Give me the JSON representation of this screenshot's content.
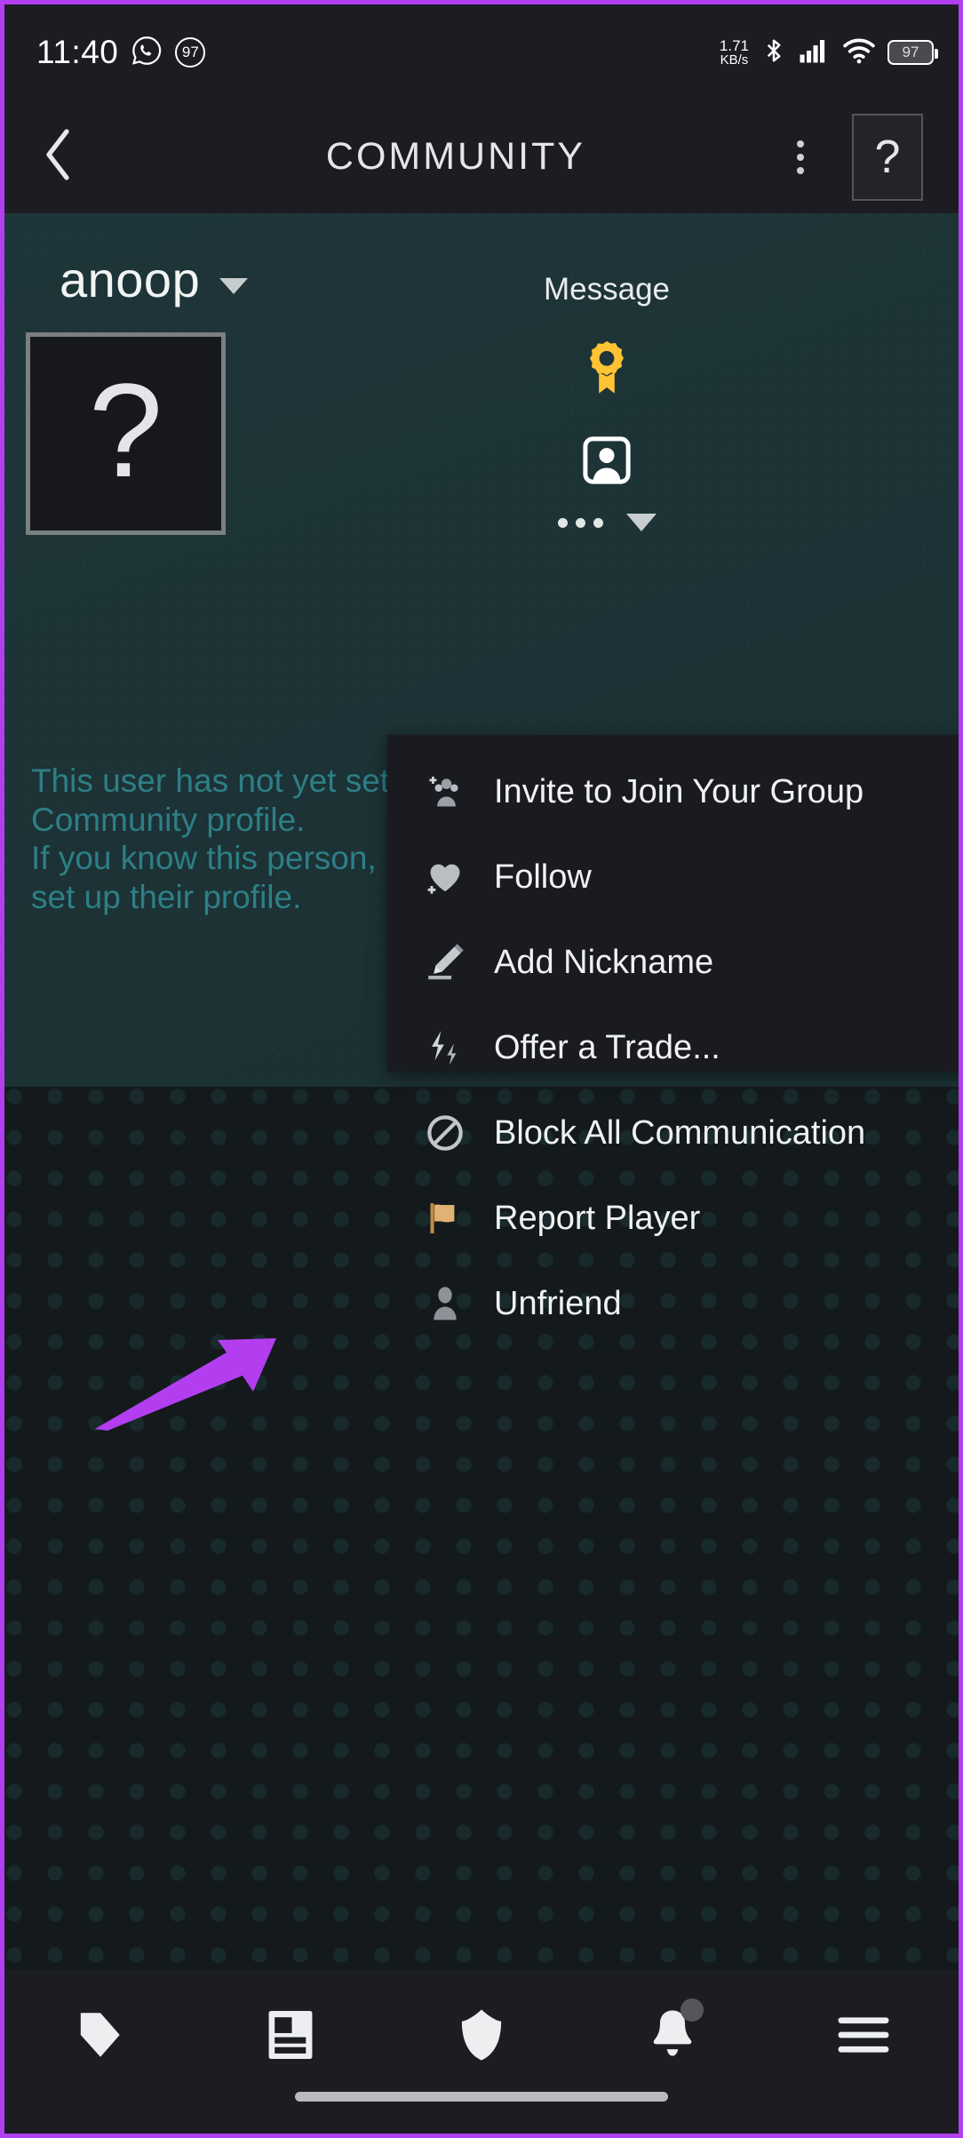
{
  "status_bar": {
    "time": "11:40",
    "whatsapp_icon": "whatsapp-icon",
    "notification_count": "97",
    "net_speed_value": "1.71",
    "net_speed_unit": "KB/s",
    "bluetooth_icon": "bluetooth-icon",
    "signal_icon": "cellular-signal-icon",
    "wifi_icon": "wifi-icon",
    "battery_level": "97"
  },
  "nav_bar": {
    "back_icon": "back-chevron-icon",
    "title": "COMMUNITY",
    "overflow_icon": "kebab-menu-icon",
    "help_label": "?"
  },
  "profile": {
    "username": "anoop",
    "dropdown_icon": "chevron-down-icon",
    "avatar_placeholder": "?",
    "message_label": "Message",
    "award_icon": "award-ribbon-icon",
    "friend_icon": "friend-avatar-icon",
    "more_label": "...",
    "more_caret_icon": "chevron-down-icon",
    "blurb_lines": [
      "This user has not yet set up a",
      "Community profile.",
      "If you know this person, ask them to",
      "set up their profile."
    ]
  },
  "context_menu": {
    "items": [
      {
        "label": "Invite to Join Your Group",
        "icon": "add-group-icon"
      },
      {
        "label": "Follow",
        "icon": "heart-plus-icon"
      },
      {
        "label": "Add Nickname",
        "icon": "pencil-icon"
      },
      {
        "label": "Offer a Trade...",
        "icon": "trade-arrows-icon"
      },
      {
        "label": "Block All Communication",
        "icon": "block-icon"
      },
      {
        "label": "Report Player",
        "icon": "flag-icon"
      },
      {
        "label": "Unfriend",
        "icon": "person-icon"
      }
    ]
  },
  "annotation": {
    "arrow_color": "#b23ef0",
    "points_to": "Unfriend"
  },
  "bottom_nav": {
    "items": [
      {
        "name": "store-tab",
        "icon": "tag-icon",
        "has_badge": false
      },
      {
        "name": "library-tab",
        "icon": "library-icon",
        "has_badge": false
      },
      {
        "name": "guard-tab",
        "icon": "shield-icon",
        "has_badge": false
      },
      {
        "name": "notifications-tab",
        "icon": "bell-icon",
        "has_badge": true
      },
      {
        "name": "menu-tab",
        "icon": "hamburger-icon",
        "has_badge": false
      }
    ]
  },
  "theme": {
    "accent_purple": "#b23ef0",
    "header_teal": "#1e3539",
    "blurb_teal": "#2d7f86",
    "chrome_dark": "#1c1d23",
    "menu_dark": "#191b21",
    "award_gold": "#ffc333",
    "flag_gold": "#d99a4e"
  }
}
